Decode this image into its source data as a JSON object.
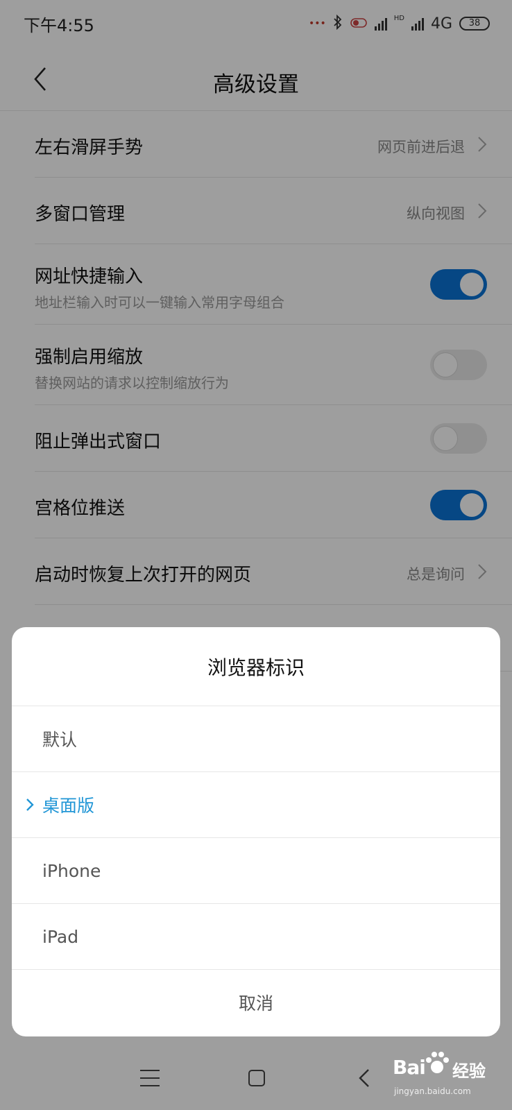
{
  "status_bar": {
    "time": "下午4:55",
    "network": "4G",
    "battery": "38",
    "hd_label": "HD"
  },
  "header": {
    "title": "高级设置"
  },
  "settings": [
    {
      "title": "左右滑屏手势",
      "value": "网页前进后退"
    },
    {
      "title": "多窗口管理",
      "value": "纵向视图"
    },
    {
      "title": "网址快捷输入",
      "subtitle": "地址栏输入时可以一键输入常用字母组合",
      "toggle": "on"
    },
    {
      "title": "强制启用缩放",
      "subtitle": "替换网站的请求以控制缩放行为",
      "toggle": "off"
    },
    {
      "title": "阻止弹出式窗口",
      "toggle": "off"
    },
    {
      "title": "宫格位推送",
      "toggle": "on"
    },
    {
      "title": "启动时恢复上次打开的网页",
      "value": "总是询问"
    }
  ],
  "dialog": {
    "title": "浏览器标识",
    "options": [
      {
        "label": "默认",
        "selected": false
      },
      {
        "label": "桌面版",
        "selected": true
      },
      {
        "label": "iPhone",
        "selected": false
      },
      {
        "label": "iPad",
        "selected": false
      }
    ],
    "cancel_label": "取消"
  },
  "watermark": {
    "logo_left": "Bai",
    "logo_right": "经验",
    "url": "jingyan.baidu.com"
  },
  "colors": {
    "accent": "#0b73d6",
    "selected_text": "#2196d6",
    "overlay": "rgba(0,0,0,0.38)"
  }
}
